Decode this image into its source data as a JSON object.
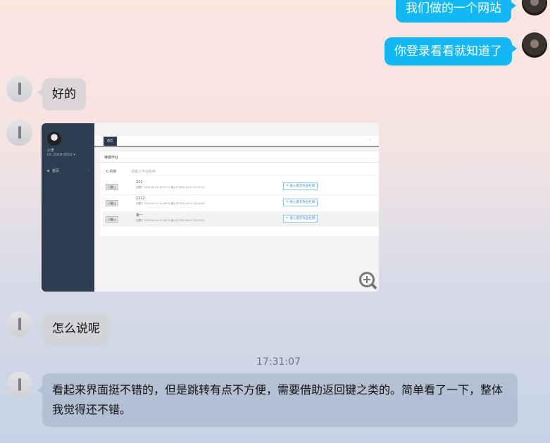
{
  "messages": {
    "m1": "我们做的一个网站",
    "m2": "你登录看看就知道了",
    "m3": "好的",
    "m4": "怎么说呢",
    "timestamp": "17:31:07",
    "m5": "看起来界面挺不错的，但是跳转有点不方便，需要借助返回键之类的。简单看了一下，整体我觉得还不错。"
  },
  "screenshot": {
    "user_name": "小李",
    "user_sub": "ID: 2018-0012 ▾",
    "nav_item": "首页",
    "tab_label": "首页",
    "panel_title": "待做作业",
    "filter_label": "⟲ 刷新",
    "search_placeholder": "请输入作业名称",
    "rows": [
      {
        "tag": "已截止",
        "name": "222",
        "meta": "创建于 2020-04-21 10:37:12 截止于2020-04-30 10:37:12",
        "action": "✎ 进入提交作业栏目"
      },
      {
        "tag": "已截止",
        "name": "2222",
        "meta": "创建于 2020-04-21 11:36:22 截止于2020-04-21 00:00:00",
        "action": "✎ 进入提交作业栏目"
      },
      {
        "tag": "已截止",
        "name": "第一",
        "meta": "创建于 2020-04-21 11:36:22 截止于2020-04-27 00:00:00",
        "action": "✎ 进入提交作业栏目"
      }
    ]
  },
  "colors": {
    "my_bubble": "#12b7f5",
    "sidebar": "#2c3e50"
  }
}
